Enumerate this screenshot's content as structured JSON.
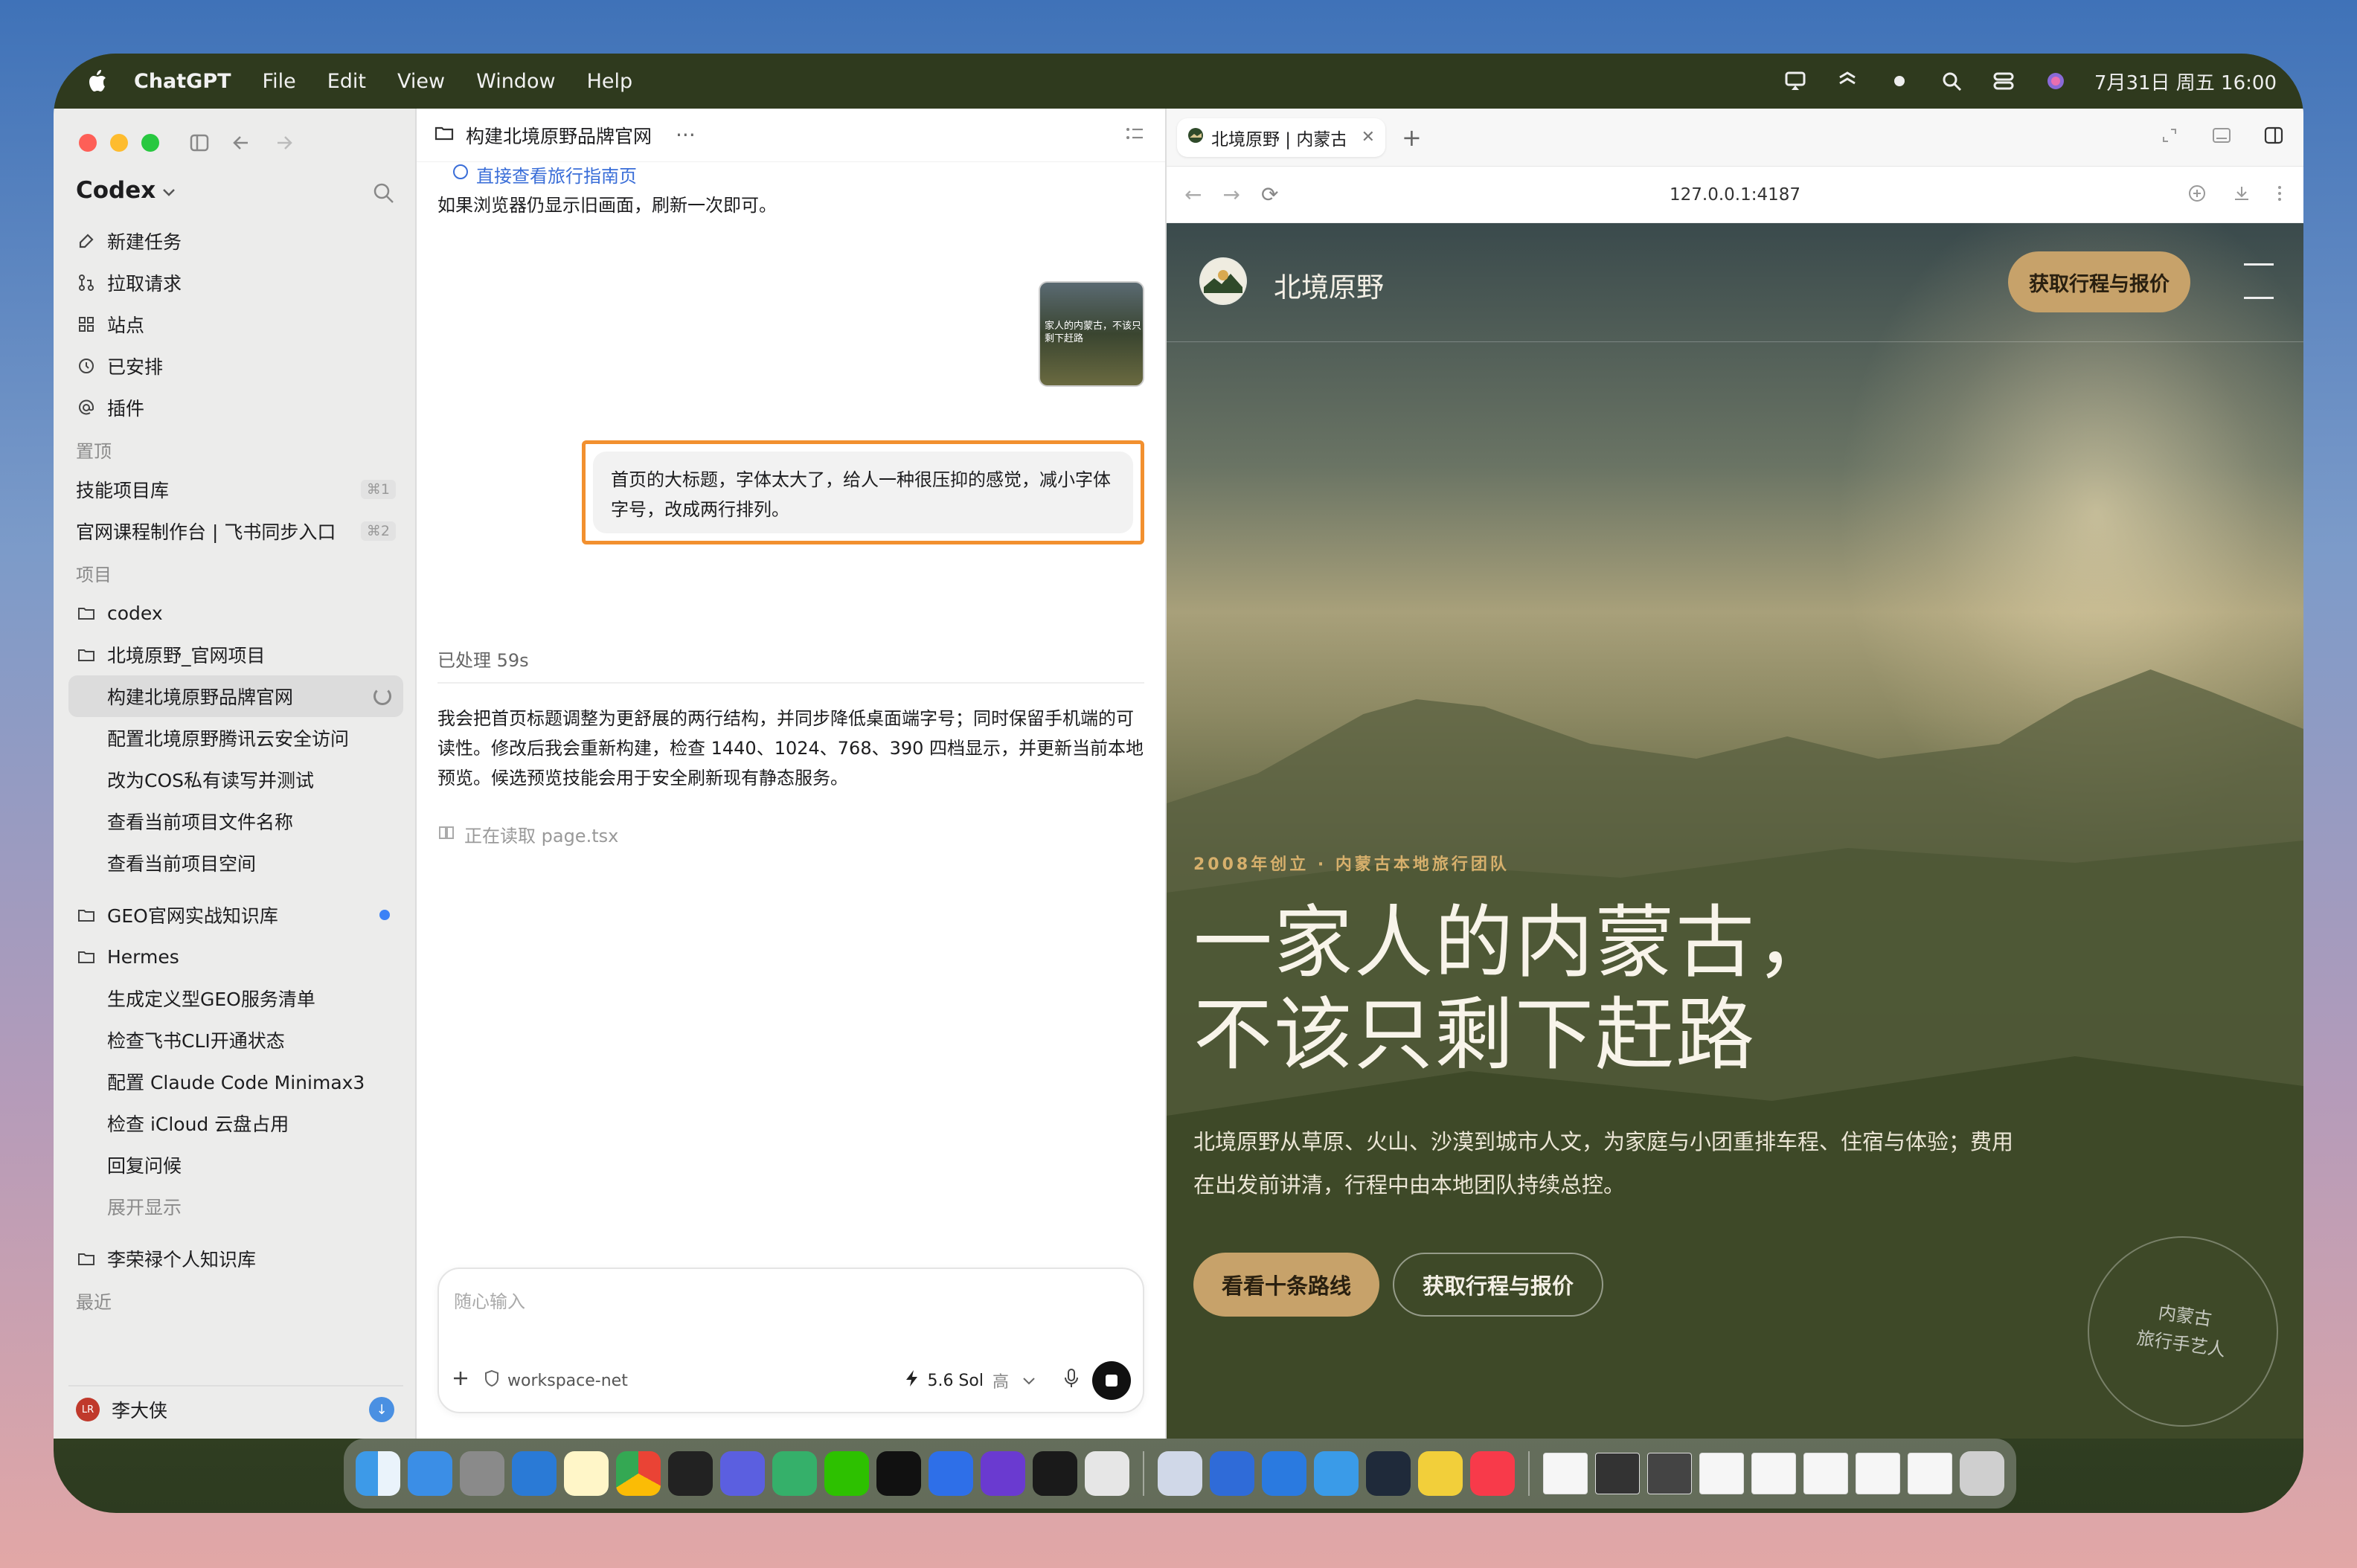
{
  "menubar": {
    "app": "ChatGPT",
    "items": [
      "File",
      "Edit",
      "View",
      "Window",
      "Help"
    ],
    "clock": "7月31日 周五  16:00"
  },
  "sidebar": {
    "brand": "Codex",
    "nav": [
      {
        "label": "新建任务",
        "icon": "edit-icon"
      },
      {
        "label": "拉取请求",
        "icon": "pull-request-icon"
      },
      {
        "label": "站点",
        "icon": "grid-icon"
      },
      {
        "label": "已安排",
        "icon": "clock-icon"
      },
      {
        "label": "插件",
        "icon": "at-icon"
      }
    ],
    "pinned_title": "置顶",
    "pinned": [
      {
        "label": "技能项目库",
        "kbd": "⌘1"
      },
      {
        "label": "官网课程制作台 | 飞书同步入口",
        "kbd": "⌘2"
      }
    ],
    "projects_title": "项目",
    "projects": [
      {
        "label": "codex",
        "type": "folder"
      },
      {
        "label": "北境原野_官网项目",
        "type": "folder"
      },
      {
        "label": "构建北境原野品牌官网",
        "type": "child",
        "active": true
      },
      {
        "label": "配置北境原野腾讯云安全访问",
        "type": "child"
      },
      {
        "label": "改为COS私有读写并测试",
        "type": "child"
      },
      {
        "label": "查看当前项目文件名称",
        "type": "child"
      },
      {
        "label": "查看当前项目空间",
        "type": "child"
      },
      {
        "label": "GEO官网实战知识库",
        "type": "folder",
        "dot": true
      },
      {
        "label": "Hermes",
        "type": "folder"
      },
      {
        "label": "生成定义型GEO服务清单",
        "type": "child"
      },
      {
        "label": "检查飞书CLI开通状态",
        "type": "child"
      },
      {
        "label": "配置 Claude Code Minimax3",
        "type": "child"
      },
      {
        "label": "检查 iCloud 云盘占用",
        "type": "child"
      },
      {
        "label": "回复问候",
        "type": "child"
      },
      {
        "label": "展开显示",
        "type": "muted"
      },
      {
        "label": "李荣禄个人知识库",
        "type": "folder"
      }
    ],
    "recent_title": "最近",
    "user": {
      "name": "李大侠",
      "initials": "LR"
    }
  },
  "chat": {
    "title": "构建北境原野品牌官网",
    "link": "直接查看旅行指南页",
    "refresh_note": "如果浏览器仍显示旧画面，刷新一次即可。",
    "thumb_text": "家人的内蒙古，不该只剩下赶路",
    "user_message": "首页的大标题，字体太大了，给人一种很压抑的感觉，减小字体字号，改成两行排列。",
    "processed": "已处理 59s",
    "reply": "我会把首页标题调整为更舒展的两行结构，并同步降低桌面端字号；同时保留手机端的可读性。修改后我会重新构建，检查 1440、1024、768、390 四档显示，并更新当前本地预览。候选预览技能会用于安全刷新现有静态服务。",
    "reading": "正在读取 page.tsx",
    "composer": {
      "placeholder": "随心输入",
      "workspace": "workspace-net",
      "model": "5.6 Sol",
      "effort": "高"
    }
  },
  "browser": {
    "tab_title": "北境原野 | 内蒙古",
    "url": "127.0.0.1:4187",
    "site": {
      "name": "北境原野",
      "cta_top": "获取行程与报价",
      "kicker": "2008年创立 · 内蒙古本地旅行团队",
      "hero_line1": "一家人的内蒙古，",
      "hero_line2": "不该只剩下赶路",
      "sub_line1": "北境原野从草原、火山、沙漠到城市人文，为家庭与小团重排车程、住宿与体验；费用",
      "sub_line2": "在出发前讲清，行程中由本地团队持续总控。",
      "btn_primary": "看看十条路线",
      "btn_secondary": "获取行程与报价",
      "stamp_line1": "内蒙古",
      "stamp_line2": "旅行手艺人"
    }
  },
  "colors": {
    "accent_gold": "#c7a26a",
    "highlight_orange": "#f2902f",
    "link_blue": "#3a6ed8"
  }
}
